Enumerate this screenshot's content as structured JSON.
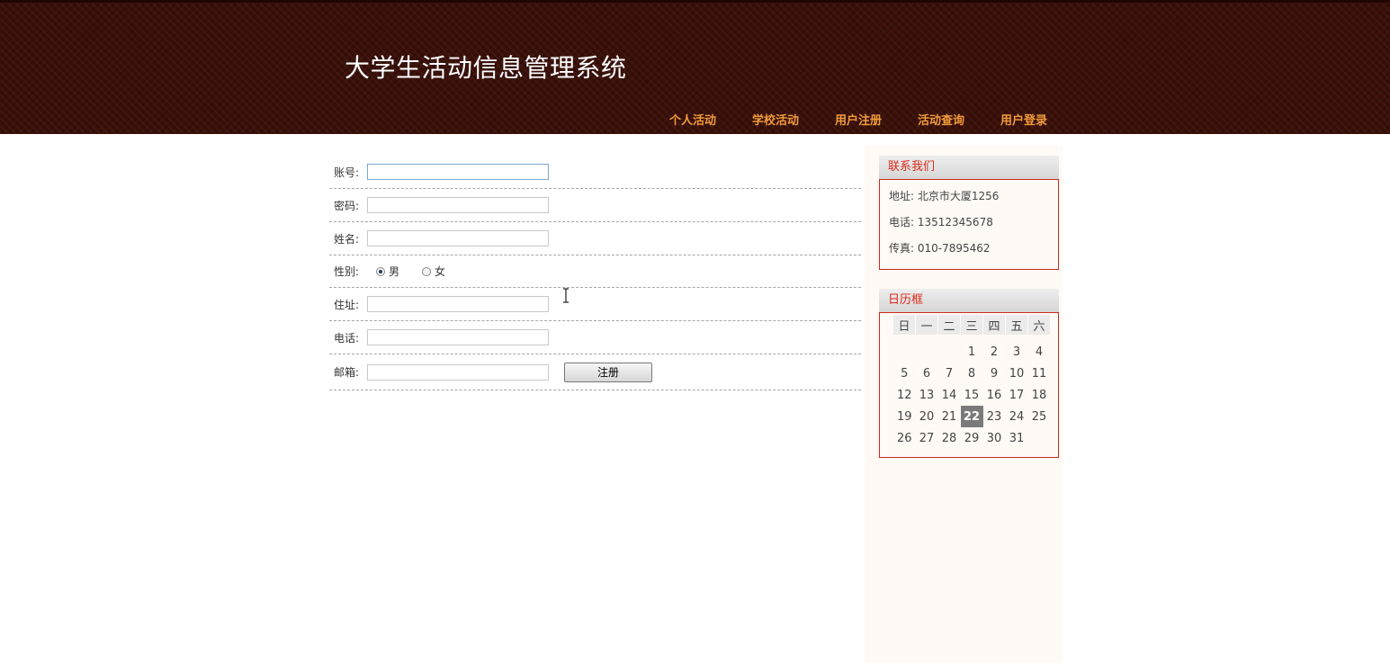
{
  "header": {
    "title": "大学生活动信息管理系统",
    "nav": [
      "个人活动",
      "学校活动",
      "用户注册",
      "活动查询",
      "用户登录"
    ]
  },
  "form": {
    "account_label": "账号:",
    "account_value": "",
    "password_label": "密码:",
    "password_value": "",
    "name_label": "姓名:",
    "name_value": "",
    "gender_label": "性别:",
    "gender_options": [
      "男",
      "女"
    ],
    "gender_selected": "男",
    "address_label": "住址:",
    "address_value": "",
    "phone_label": "电话:",
    "phone_value": "",
    "email_label": "邮箱:",
    "email_value": "",
    "submit_label": "注册"
  },
  "contact": {
    "title": "联系我们",
    "address": "地址: 北京市大厦1256",
    "phone": "电话: 13512345678",
    "fax": "传真: 010-7895462"
  },
  "calendar": {
    "title": "日历框",
    "weekdays": [
      "日",
      "一",
      "二",
      "三",
      "四",
      "五",
      "六"
    ],
    "weeks": [
      [
        "",
        "",
        "",
        "1",
        "2",
        "3",
        "4"
      ],
      [
        "5",
        "6",
        "7",
        "8",
        "9",
        "10",
        "11"
      ],
      [
        "12",
        "13",
        "14",
        "15",
        "16",
        "17",
        "18"
      ],
      [
        "19",
        "20",
        "21",
        "22",
        "23",
        "24",
        "25"
      ],
      [
        "26",
        "27",
        "28",
        "29",
        "30",
        "31",
        ""
      ]
    ],
    "today": "22"
  },
  "colors": {
    "header_bg": "#3a1009",
    "nav_text": "#f29b3d",
    "panel_title": "#d92a1c",
    "panel_border": "#cc2b22",
    "sidebar_bg": "#fffaf5",
    "today_bg": "#7a7a7a"
  }
}
